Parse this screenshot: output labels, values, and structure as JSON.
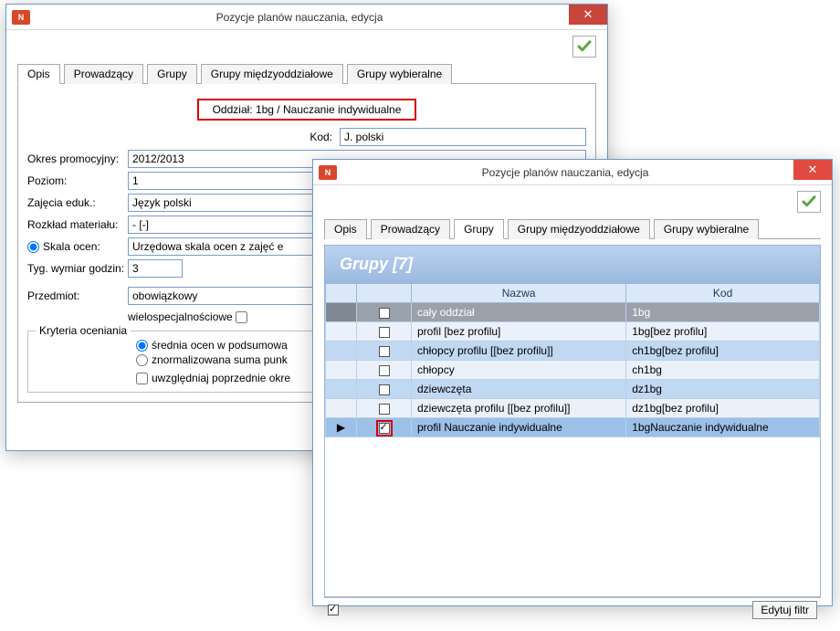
{
  "window1": {
    "title": "Pozycje planów nauczania, edycja",
    "tabs": [
      "Opis",
      "Prowadzący",
      "Grupy",
      "Grupy międzyoddziałowe",
      "Grupy wybieralne"
    ],
    "active_tab": 0,
    "oddzial_label": "Oddział: 1bg / Nauczanie indywidualne",
    "fields": {
      "kod_label": "Kod:",
      "kod_value": "J. polski",
      "okres_label": "Okres promocyjny:",
      "okres_value": "2012/2013",
      "poziom_label": "Poziom:",
      "poziom_value": "1",
      "zajecia_label": "Zajęcia eduk.:",
      "zajecia_value": "Język polski",
      "rozklad_label": "Rozkład materiału:",
      "rozklad_value": "- [-]",
      "skala_label": "Skala ocen:",
      "skala_value": "Urzędowa skala ocen z zajęć e",
      "tyg_label": "Tyg. wymiar godzin:",
      "tyg_value": "3",
      "przedmiot_label": "Przedmiot:",
      "przedmiot_value": "obowiązkowy",
      "wielosp_label": "wielospecjalnościowe",
      "kryteria_legend": "Kryteria oceniania",
      "srednia_label": "średnia ocen w podsumowa",
      "znorm_label": "znormalizowana suma punk",
      "uwzgl_label": "uwzględniaj poprzednie okre"
    }
  },
  "window2": {
    "title": "Pozycje planów nauczania, edycja",
    "tabs": [
      "Opis",
      "Prowadzący",
      "Grupy",
      "Grupy międzyoddziałowe",
      "Grupy wybieralne"
    ],
    "active_tab": 2,
    "banner": "Grupy [7]",
    "columns": {
      "nazwa": "Nazwa",
      "kod": "Kod"
    },
    "rows": [
      {
        "checked": false,
        "nazwa": "cały oddział",
        "kod": "1bg",
        "header": true
      },
      {
        "checked": false,
        "nazwa": "profil [bez profilu]",
        "kod": "1bg[bez profilu]"
      },
      {
        "checked": false,
        "nazwa": "chłopcy profilu [[bez profilu]]",
        "kod": "ch1bg[bez profilu]"
      },
      {
        "checked": false,
        "nazwa": "chłopcy",
        "kod": "ch1bg"
      },
      {
        "checked": false,
        "nazwa": "dziewczęta",
        "kod": "dz1bg"
      },
      {
        "checked": false,
        "nazwa": "dziewczęta profilu [[bez profilu]]",
        "kod": "dz1bg[bez profilu]"
      },
      {
        "checked": true,
        "nazwa": "profil Nauczanie indywidualne",
        "kod": "1bgNauczanie indywidualne",
        "selected": true,
        "red": true
      }
    ],
    "footer": {
      "edit_filter": "Edytuj filtr"
    }
  }
}
